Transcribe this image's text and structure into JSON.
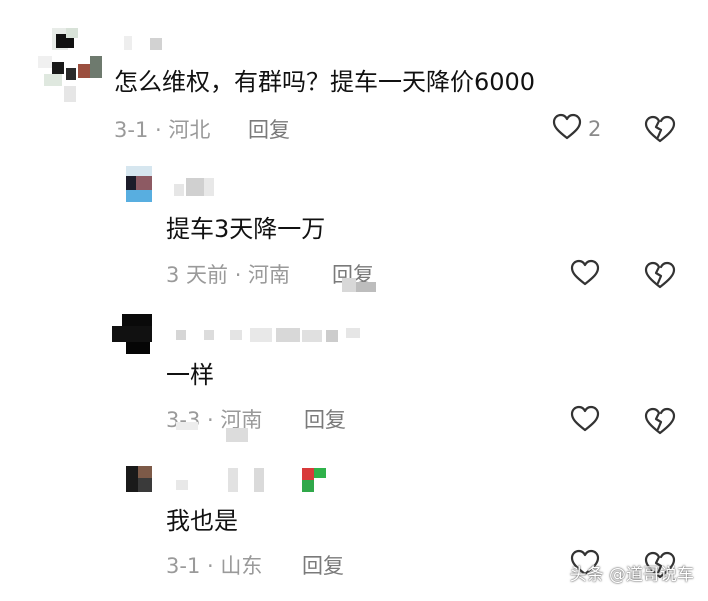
{
  "comments": [
    {
      "text": "怎么维权，有群吗？提车一天降价6000",
      "meta": "3-1 · 河北",
      "reply_label": "回复",
      "like_count": "2"
    },
    {
      "text": "提车3天降一万",
      "meta": "3 天前 · 河南",
      "reply_label": "回复"
    },
    {
      "text": "一样",
      "meta": "3-3 · 河南",
      "reply_label": "回复"
    },
    {
      "text": "我也是",
      "meta": "3-1 · 山东",
      "reply_label": "回复"
    }
  ],
  "watermark": "头条 @道哥说车",
  "icons": {
    "like": "heart-outline-icon",
    "dislike": "broken-heart-icon"
  },
  "colors": {
    "text": "#111111",
    "meta": "#9a9a9a",
    "icon": "#333333"
  }
}
